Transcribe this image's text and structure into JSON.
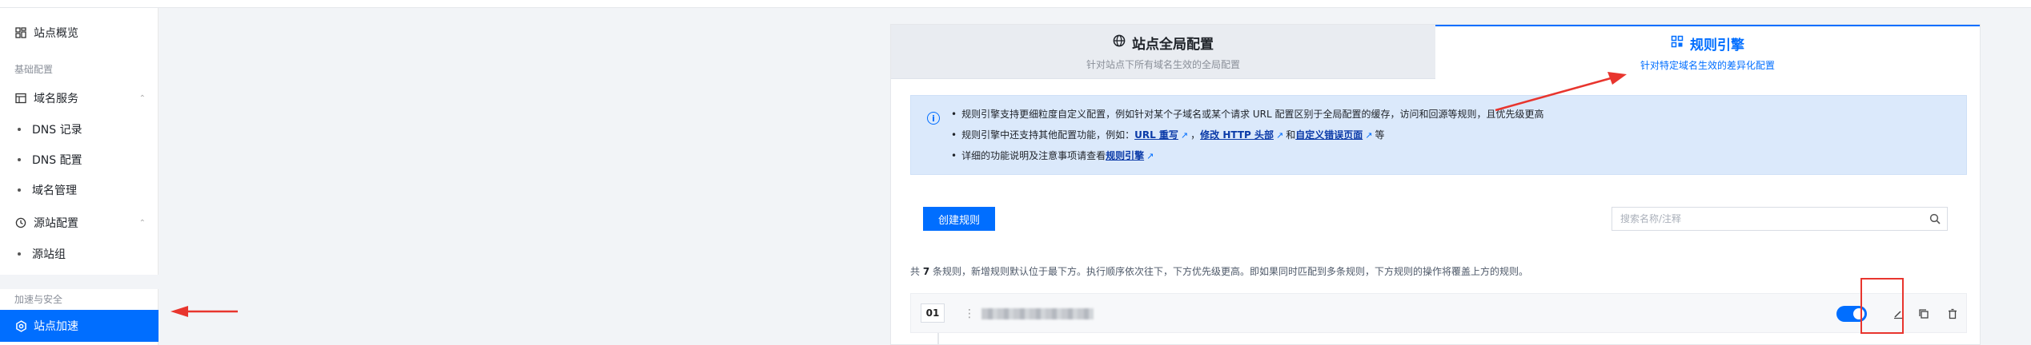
{
  "sidebar": {
    "overview": {
      "label": "站点概览",
      "icon": "dashboard-icon"
    },
    "group_basic": "基础配置",
    "domain_service": {
      "label": "域名服务",
      "icon": "server-icon"
    },
    "dns_record": "DNS 记录",
    "dns_config": "DNS 配置",
    "domain_manage": "域名管理",
    "origin_config": {
      "label": "源站配置",
      "icon": "history-icon"
    },
    "origin_group": "源站组",
    "group_security": "加速与安全",
    "site_accel": {
      "label": "站点加速",
      "icon": "settings-icon"
    }
  },
  "tabs": {
    "global": {
      "title": "站点全局配置",
      "subtitle": "针对站点下所有域名生效的全局配置",
      "icon": "globe-icon"
    },
    "rules": {
      "title": "规则引擎",
      "subtitle": "针对特定域名生效的差异化配置",
      "icon": "grid-icon"
    }
  },
  "info": {
    "line1": "规则引擎支持更细粒度自定义配置，例如针对某个子域名或某个请求 URL 配置区别于全局配置的缓存，访问和回源等规则，且优先级更高",
    "line2_pre": "规则引擎中还支持其他配置功能，例如：",
    "line2_link1": "URL 重写",
    "line2_sep1": "，",
    "line2_link2": "修改 HTTP 头部",
    "line2_sep2": "和",
    "line2_link3": "自定义错误页面",
    "line2_post": "等",
    "line3_pre": "详细的功能说明及注意事项请查看",
    "line3_link": "规则引擎"
  },
  "toolbar": {
    "create_label": "创建规则",
    "search_placeholder": "搜索名称/注释"
  },
  "count": {
    "pre": "共",
    "num": "7",
    "post": "条规则，新增规则默认位于最下方。执行顺序依次往下，下方优先级更高。即如果同时匹配到多条规则，下方规则的操作将覆盖上方的规则。"
  },
  "rule": {
    "index": "01",
    "enabled": true
  },
  "colors": {
    "accent": "#006eff",
    "annotation": "#e8352e"
  }
}
